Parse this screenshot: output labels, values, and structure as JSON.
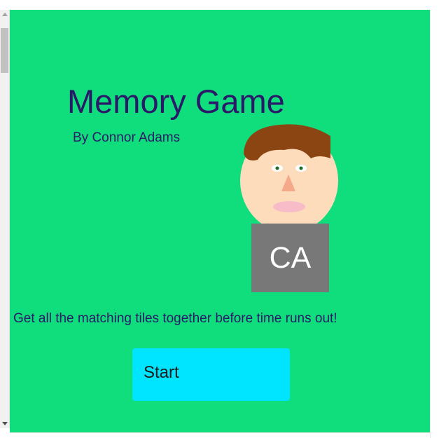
{
  "game": {
    "title": "Memory Game",
    "byline": "By Connor Adams",
    "monogram": "CA",
    "tagline": "Get all the matching tiles together before time runs out!",
    "start_label": "Start"
  },
  "colors": {
    "background": "#10dd7b",
    "text": "#2a1868",
    "button": "#00e5ff",
    "monogram_box": "#777877",
    "hair": "#8b4513",
    "skin": "#fddcbb",
    "mouth": "#f8bcc8",
    "nose": "#f6a98a"
  },
  "icons": [
    "avatar-face-icon",
    "scroll-up-arrow-icon",
    "scroll-down-arrow-icon"
  ]
}
